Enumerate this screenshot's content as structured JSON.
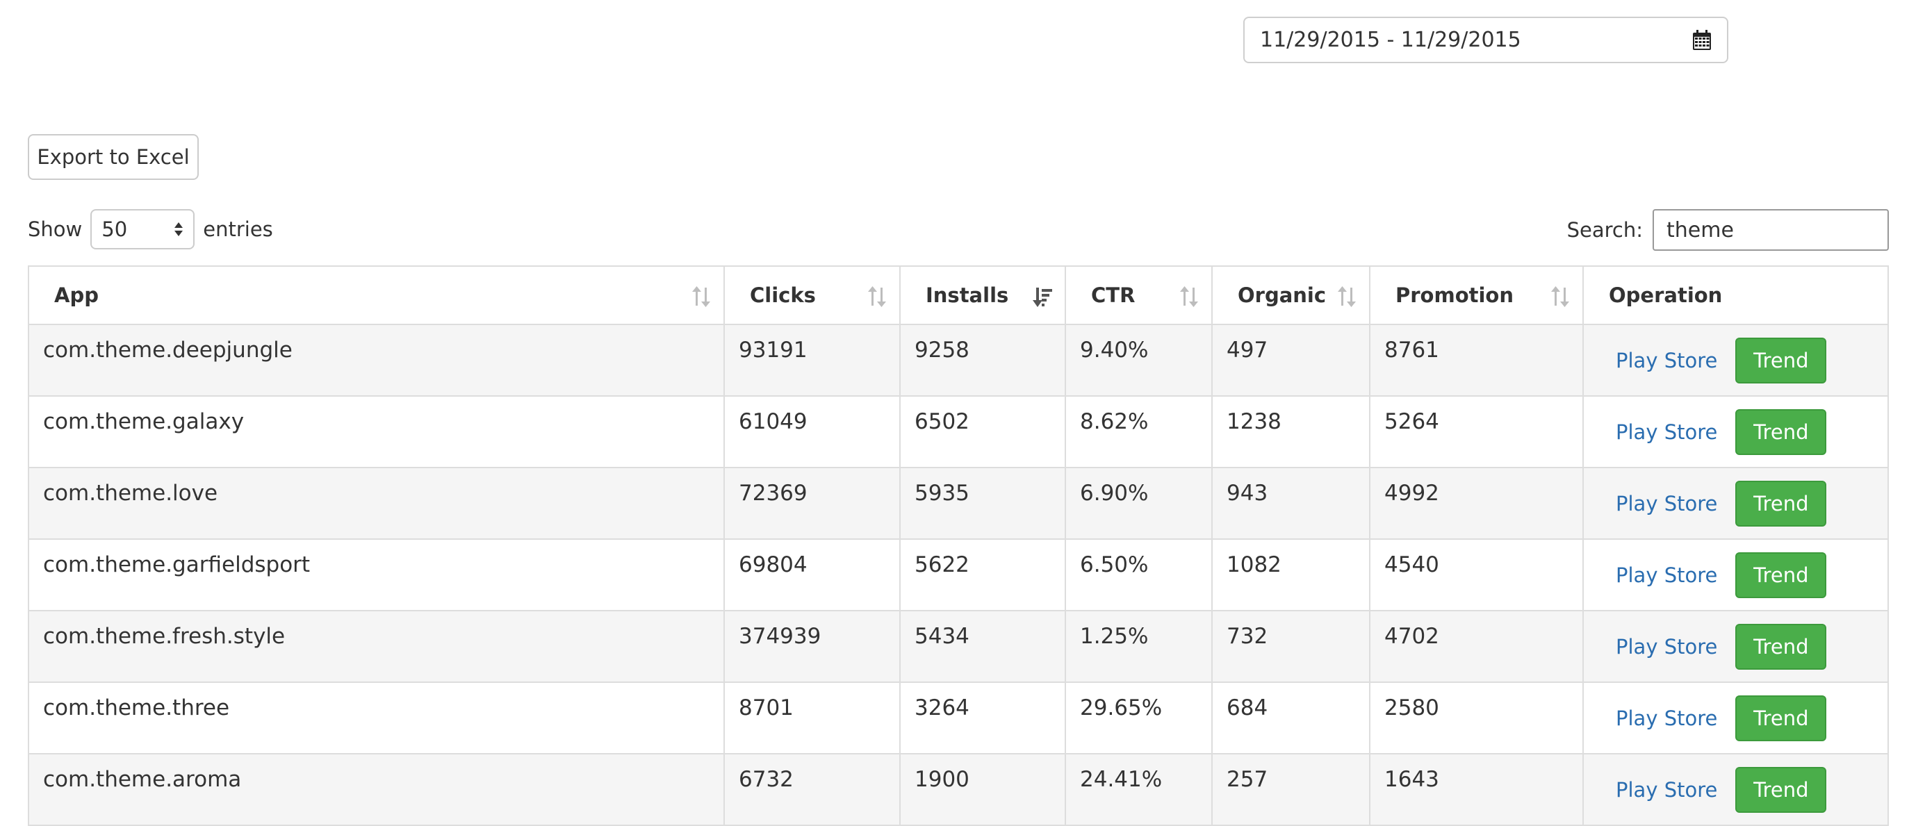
{
  "date_range": {
    "value": "11/29/2015 - 11/29/2015",
    "icon": "calendar-icon"
  },
  "toolbar": {
    "export_label": "Export to Excel"
  },
  "length": {
    "show_label": "Show",
    "selected": "50",
    "entries_label": "entries"
  },
  "search": {
    "label": "Search:",
    "value": "theme"
  },
  "table": {
    "columns": [
      {
        "label": "App",
        "sort": "none"
      },
      {
        "label": "Clicks",
        "sort": "none"
      },
      {
        "label": "Installs",
        "sort": "descending"
      },
      {
        "label": "CTR",
        "sort": "none"
      },
      {
        "label": "Organic",
        "sort": "none"
      },
      {
        "label": "Promotion",
        "sort": "none"
      },
      {
        "label": "Operation"
      }
    ],
    "rows": [
      {
        "app": "com.theme.deepjungle",
        "clicks": "93191",
        "installs": "9258",
        "ctr": "9.40%",
        "organic": "497",
        "promotion": "8761"
      },
      {
        "app": "com.theme.galaxy",
        "clicks": "61049",
        "installs": "6502",
        "ctr": "8.62%",
        "organic": "1238",
        "promotion": "5264"
      },
      {
        "app": "com.theme.love",
        "clicks": "72369",
        "installs": "5935",
        "ctr": "6.90%",
        "organic": "943",
        "promotion": "4992"
      },
      {
        "app": "com.theme.garfieldsport",
        "clicks": "69804",
        "installs": "5622",
        "ctr": "6.50%",
        "organic": "1082",
        "promotion": "4540"
      },
      {
        "app": "com.theme.fresh.style",
        "clicks": "374939",
        "installs": "5434",
        "ctr": "1.25%",
        "organic": "732",
        "promotion": "4702"
      },
      {
        "app": "com.theme.three",
        "clicks": "8701",
        "installs": "3264",
        "ctr": "29.65%",
        "organic": "684",
        "promotion": "2580"
      },
      {
        "app": "com.theme.aroma",
        "clicks": "6732",
        "installs": "1900",
        "ctr": "24.41%",
        "organic": "257",
        "promotion": "1643"
      }
    ],
    "operation": {
      "play_store_label": "Play Store",
      "trend_label": "Trend"
    }
  },
  "colors": {
    "trend_button": "#4aae4a",
    "link": "#2a6db0",
    "row_stripe": "#f5f5f5",
    "border": "#dddddd"
  }
}
